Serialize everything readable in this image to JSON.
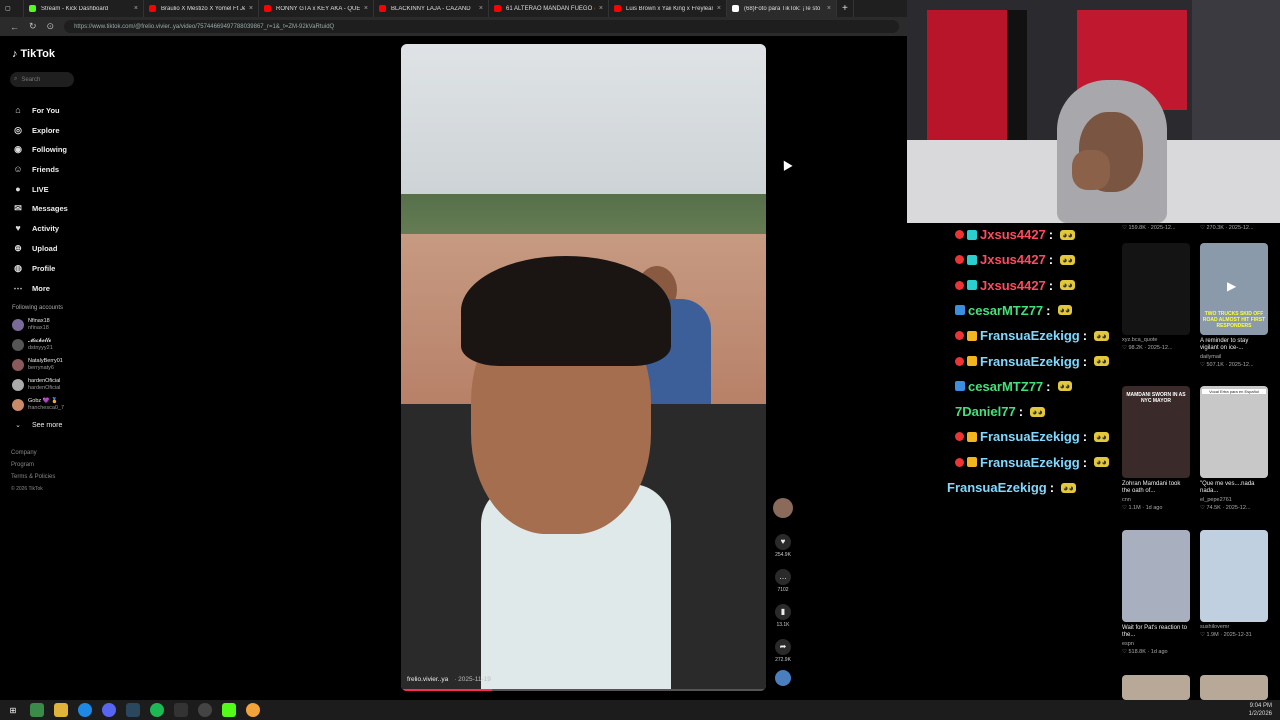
{
  "browser": {
    "tabs": [
      {
        "label": "Stream - Kick Dashboard",
        "color": "#53fc18"
      },
      {
        "label": "Braulio X Mestizo X Yomel Ft Jey",
        "color": "#ff0000"
      },
      {
        "label": "RONNY GTA x KEY AKA - QUE TE",
        "color": "#ff0000"
      },
      {
        "label": "BLACKINNY LAJA - CAZAND",
        "color": "#ff0000"
      },
      {
        "label": "61 ALTERAO MANDAN FUEGO 🔥",
        "color": "#ff0000"
      },
      {
        "label": "Luis Brown x Yaii King x Freylean",
        "color": "#ff0000"
      },
      {
        "label": "(68)Foto para TikTok: ¡Te sto",
        "color": "#ffffff"
      }
    ],
    "url": "https://www.tiktok.com/@frelio.vivier..ya/video/75744669497788039867_r=1&_t=ZM-92kVaRtuidQ"
  },
  "tiktok": {
    "logo": "TikTok",
    "search_placeholder": "Search",
    "nav": [
      {
        "label": "For You",
        "icon": "home-icon"
      },
      {
        "label": "Explore",
        "icon": "compass-icon"
      },
      {
        "label": "Following",
        "icon": "following-icon"
      },
      {
        "label": "Friends",
        "icon": "friends-icon"
      },
      {
        "label": "LIVE",
        "icon": "live-icon"
      },
      {
        "label": "Messages",
        "icon": "messages-icon"
      },
      {
        "label": "Activity",
        "icon": "activity-icon"
      },
      {
        "label": "Upload",
        "icon": "upload-icon"
      },
      {
        "label": "Profile",
        "icon": "profile-icon"
      },
      {
        "label": "More",
        "icon": "more-icon"
      }
    ],
    "following_header": "Following accounts",
    "accounts": [
      {
        "name": "Nfinax18",
        "handle": "nfinax18"
      },
      {
        "name": "𝓜𝓲𝓬𝓱𝓮𝓵𝓵𝓮",
        "handle": "dstnyyy21"
      },
      {
        "name": "NatalyBerry01",
        "handle": "berrynaty6"
      },
      {
        "name": "hardenOficial",
        "handle": "hardenOficial"
      },
      {
        "name": "Gobz 💜 🏅",
        "handle": "franchesca0_7"
      }
    ],
    "see_more": "See more",
    "footer": [
      "Company",
      "Program",
      "Terms & Policies",
      "© 2026 TikTok"
    ],
    "video": {
      "username": "frelio.vivier..ya",
      "date": "· 2025-11-19",
      "progress": 0.25
    },
    "actions": [
      {
        "icon": "heart-icon",
        "count": "254.9K"
      },
      {
        "icon": "comment-icon",
        "count": "7102"
      },
      {
        "icon": "bookmark-icon",
        "count": "13.1K"
      },
      {
        "icon": "share-icon",
        "count": "272.9K"
      }
    ]
  },
  "chat": {
    "messages": [
      {
        "user": "Jxsus4427",
        "color": "#ff4a5e",
        "badges": [
          "red",
          "cyan"
        ]
      },
      {
        "user": "Jxsus4427",
        "color": "#ff4a5e",
        "badges": [
          "red",
          "cyan"
        ]
      },
      {
        "user": "Jxsus4427",
        "color": "#ff4a5e",
        "badges": [
          "red",
          "cyan"
        ]
      },
      {
        "user": "cesarMTZ77",
        "color": "#43e17a",
        "badges": [
          "blue"
        ]
      },
      {
        "user": "FransuaEzekigg",
        "color": "#7fd9ff",
        "badges": [
          "red",
          "gold"
        ]
      },
      {
        "user": "FransuaEzekigg",
        "color": "#7fd9ff",
        "badges": [
          "red",
          "gold"
        ]
      },
      {
        "user": "cesarMTZ77",
        "color": "#43e17a",
        "badges": [
          "blue"
        ]
      },
      {
        "user": "7Daniel77",
        "color": "#43e17a",
        "badges": []
      },
      {
        "user": "FransuaEzekigg",
        "color": "#7fd9ff",
        "badges": [
          "red",
          "gold"
        ]
      },
      {
        "user": "FransuaEzekigg",
        "color": "#7fd9ff",
        "badges": [
          "red",
          "gold"
        ]
      },
      {
        "user": "FransuaEzekigg",
        "color": "#7fd9ff",
        "badges": []
      }
    ]
  },
  "recs": [
    {
      "title": "",
      "author": "",
      "meta": "♡ 159.8K · 2025-12..."
    },
    {
      "title": "",
      "author": "",
      "meta": "♡ 270.3K · 2025-12..."
    },
    {
      "title": "",
      "author": "xyz.bca_quote",
      "meta": "♡ 98.2K · 2025-12..."
    },
    {
      "title": "A reminder to stay vigilant on ice-...",
      "author": "dailymail",
      "meta": "♡ 507.1K · 2025-12..."
    },
    {
      "title": "Zohran Mamdani took the oath of...",
      "author": "cnn",
      "meta": "♡ 1.1M · 1d ago"
    },
    {
      "title": "\"Que me ves....nada nada...",
      "author": "el_pepe2761",
      "meta": "♡ 74.5K · 2025-12..."
    },
    {
      "title": "Wait for Pat's reaction to the...",
      "author": "espn",
      "meta": "♡ 518.8K · 1d ago"
    },
    {
      "title": "",
      "author": "sushilovemr",
      "meta": "♡ 1.9M · 2025-12-31"
    }
  ],
  "thumb_texts": [
    "TWO TRUCKS SKID OFF ROAD ALMOST HIT FIRST RESPONDERS",
    "MAMDANI SWORN IN AS NYC MAYOR",
    "Vocal Ertra para en Español"
  ],
  "clock": {
    "time": "9:04 PM",
    "date": "1/2/2026"
  }
}
